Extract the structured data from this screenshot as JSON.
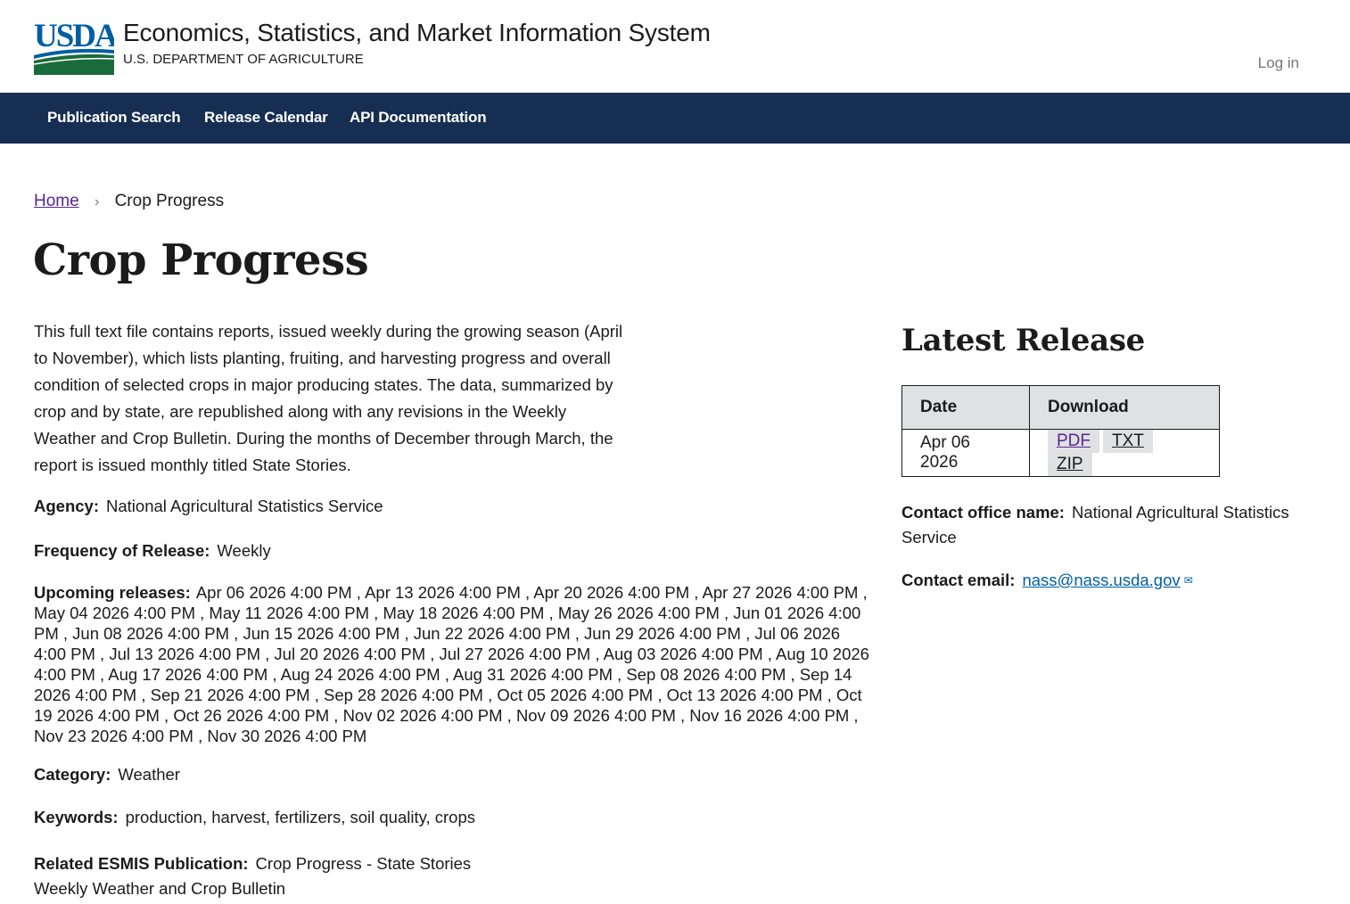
{
  "header": {
    "logo_text": "USDA",
    "title": "Economics, Statistics, and Market Information System",
    "subtitle": "U.S. DEPARTMENT OF AGRICULTURE",
    "login_label": "Log in"
  },
  "nav": {
    "items": [
      {
        "label": "Publication Search"
      },
      {
        "label": "Release Calendar"
      },
      {
        "label": "API Documentation"
      }
    ]
  },
  "breadcrumb": {
    "home": "Home",
    "current": "Crop Progress"
  },
  "page_title": "Crop Progress",
  "description": "This full text file contains reports, issued weekly during the growing season (April to November), which lists planting, fruiting, and harvesting progress and overall condition of selected crops in major producing states. The data, summarized by crop and by state, are republished along with any revisions in the Weekly Weather and Crop Bulletin. During the months of December through March, the report is issued monthly titled State Stories.",
  "fields": {
    "agency_label": "Agency:",
    "agency_value": "National Agricultural Statistics Service",
    "frequency_label": "Frequency of Release:",
    "frequency_value": "Weekly",
    "upcoming_label": "Upcoming releases:",
    "upcoming_value": "Apr 06 2026 4:00 PM , Apr 13 2026 4:00 PM , Apr 20 2026 4:00 PM , Apr 27 2026 4:00 PM , May 04 2026 4:00 PM , May 11 2026 4:00 PM , May 18 2026 4:00 PM , May 26 2026 4:00 PM , Jun 01 2026 4:00 PM , Jun 08 2026 4:00 PM , Jun 15 2026 4:00 PM , Jun 22 2026 4:00 PM , Jun 29 2026 4:00 PM , Jul 06 2026 4:00 PM , Jul 13 2026 4:00 PM , Jul 20 2026 4:00 PM , Jul 27 2026 4:00 PM , Aug 03 2026 4:00 PM , Aug 10 2026 4:00 PM , Aug 17 2026 4:00 PM , Aug 24 2026 4:00 PM , Aug 31 2026 4:00 PM , Sep 08 2026 4:00 PM , Sep 14 2026 4:00 PM , Sep 21 2026 4:00 PM , Sep 28 2026 4:00 PM , Oct 05 2026 4:00 PM , Oct 13 2026 4:00 PM , Oct 19 2026 4:00 PM , Oct 26 2026 4:00 PM , Nov 02 2026 4:00 PM , Nov 09 2026 4:00 PM , Nov 16 2026 4:00 PM , Nov 23 2026 4:00 PM , Nov 30 2026 4:00 PM",
    "category_label": "Category:",
    "category_value": "Weather",
    "keywords_label": "Keywords:",
    "keywords_value": "production, harvest, fertilizers, soil quality, crops",
    "related_label": "Related ESMIS Publication:",
    "related_items": [
      "Crop Progress - State Stories",
      "Weekly Weather and Crop Bulletin"
    ]
  },
  "latest_release": {
    "title": "Latest Release",
    "col_date": "Date",
    "col_download": "Download",
    "date": "Apr 06 2026",
    "downloads": [
      "PDF",
      "TXT",
      "ZIP"
    ]
  },
  "contact": {
    "office_label": "Contact office name:",
    "office_value": "National Agricultural Statistics Service",
    "email_label": "Contact email:",
    "email_value": "nass@nass.usda.gov"
  },
  "colors": {
    "nav_bg": "#162e51",
    "link_visited": "#54278f",
    "link": "#005ea2",
    "usda_blue": "#005ea2",
    "usda_green": "#1a6b3c"
  }
}
